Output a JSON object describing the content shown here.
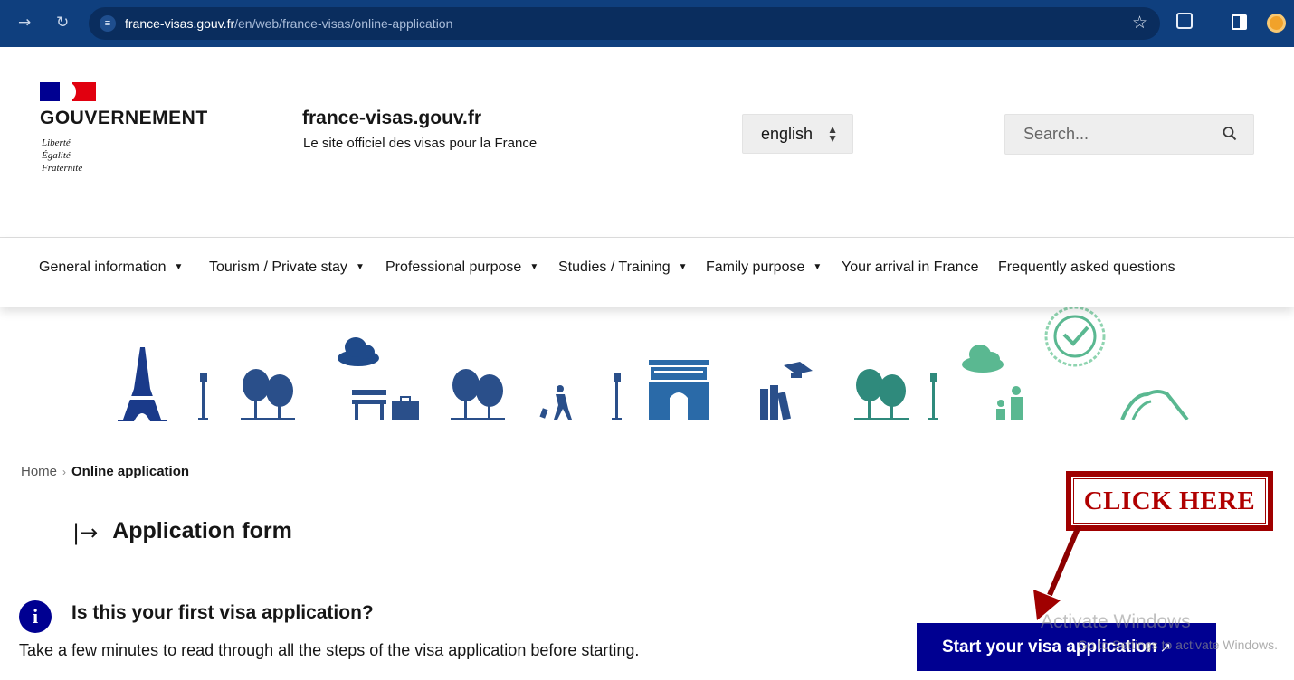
{
  "browser": {
    "url_host": "france-visas.gouv.fr",
    "url_path": "/en/web/france-visas/online-application"
  },
  "header": {
    "gov_title": "GOUVERNEMENT",
    "motto": [
      "Liberté",
      "Égalité",
      "Fraternité"
    ],
    "site_name": "france-visas.gouv.fr",
    "site_tagline": "Le site officiel des visas pour la France",
    "language": "english",
    "search_placeholder": "Search..."
  },
  "nav": {
    "items": [
      {
        "label": "General information",
        "has_dropdown": true
      },
      {
        "label": "Tourism / Private stay",
        "has_dropdown": true
      },
      {
        "label": "Professional purpose",
        "has_dropdown": true
      },
      {
        "label": "Studies / Training",
        "has_dropdown": true
      },
      {
        "label": "Family purpose",
        "has_dropdown": true
      },
      {
        "label": "Your arrival in France",
        "has_dropdown": false
      },
      {
        "label": "Frequently asked questions",
        "has_dropdown": false
      }
    ]
  },
  "breadcrumb": {
    "home": "Home",
    "separator": "›",
    "current": "Online application"
  },
  "content": {
    "form_heading": "Application form",
    "first_question": "Is this your first visa application?",
    "first_description": "Take a few minutes to read through all the steps of the visa application before starting.",
    "start_button": "Start your visa application"
  },
  "annotation": {
    "callout": "CLICK HERE"
  },
  "watermark": {
    "title": "Activate Windows",
    "subtitle": "Go to Settings to activate Windows."
  },
  "colors": {
    "chrome": "#0f3f7e",
    "brand_blue": "#000091",
    "marianne_red": "#e1000f",
    "illustration_blue": "#2a4f8a",
    "illustration_green": "#5ab891",
    "callout_red": "#a00000"
  }
}
